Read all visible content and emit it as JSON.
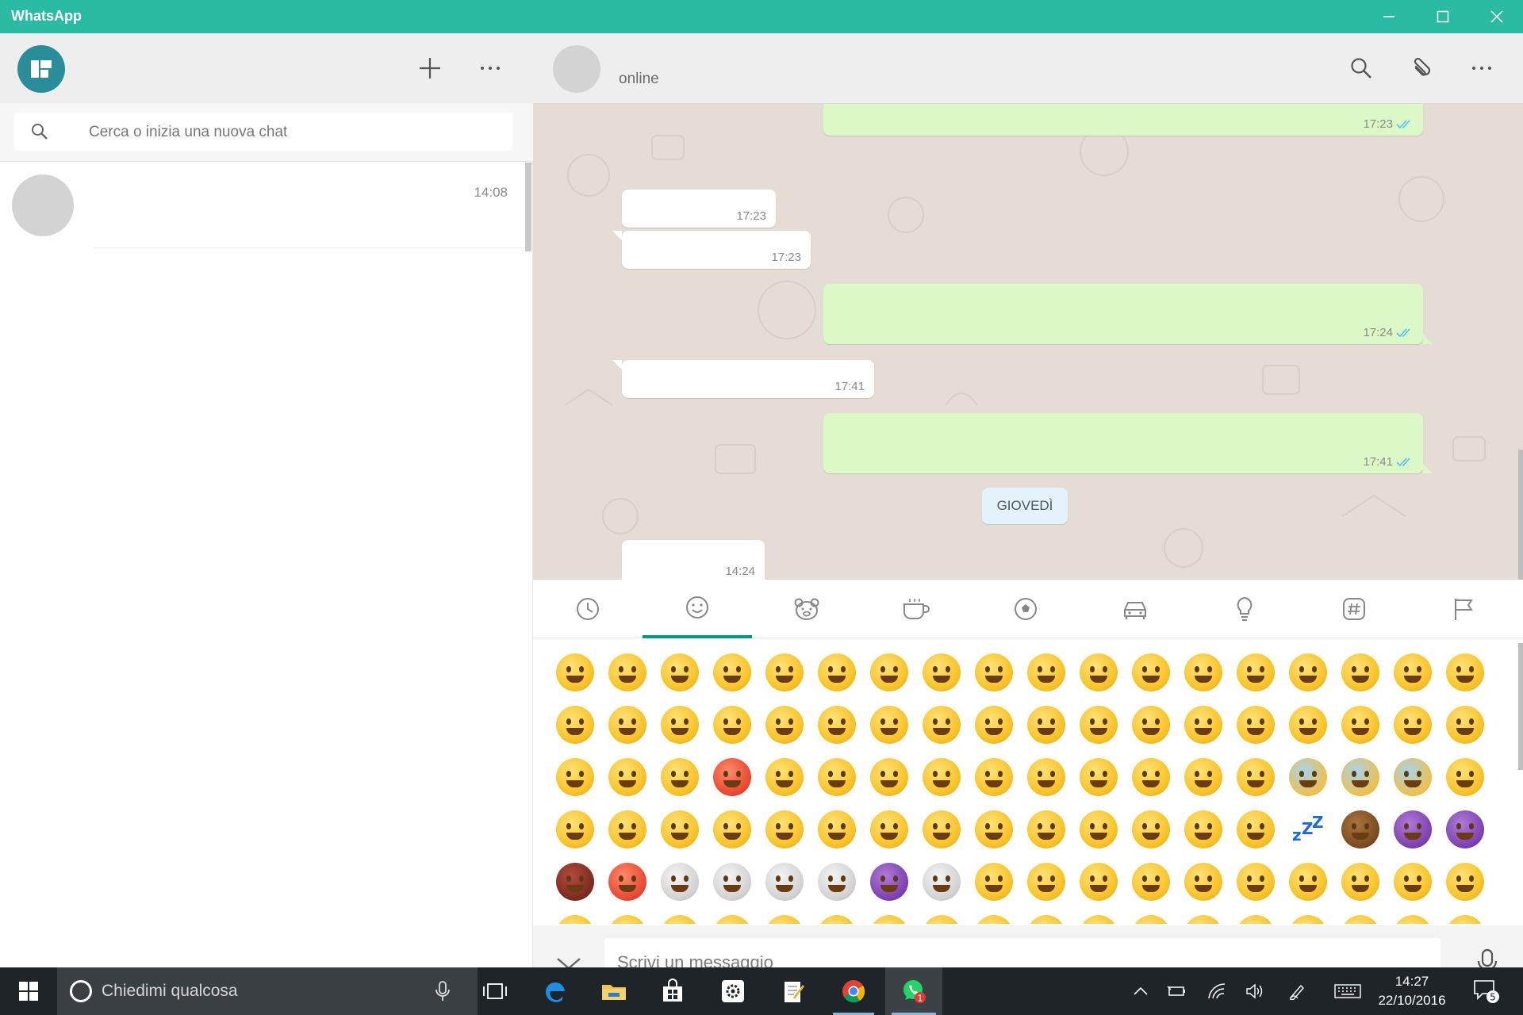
{
  "window": {
    "title": "WhatsApp",
    "accent_color": "#2bbba4"
  },
  "left_panel": {
    "search_placeholder": "Cerca o inizia una nuova chat",
    "chats": [
      {
        "time": "14:08"
      }
    ]
  },
  "chat": {
    "contact_status": "online",
    "messages": [
      {
        "dir": "out",
        "time": "17:23",
        "ticks": "read"
      },
      {
        "dir": "in",
        "time": "17:23"
      },
      {
        "dir": "in",
        "time": "17:23"
      },
      {
        "dir": "out",
        "time": "17:24",
        "ticks": "read"
      },
      {
        "dir": "in",
        "time": "17:41"
      },
      {
        "dir": "out",
        "time": "17:41",
        "ticks": "read"
      },
      {
        "dir": "in",
        "time": "14:24"
      }
    ],
    "day_separator": "GIOVEDÌ",
    "incoming_color": "#ffffff",
    "outgoing_color": "#dcf8c6",
    "read_tick_color": "#4fc3f7"
  },
  "emoji_panel": {
    "tabs": [
      "clock-icon",
      "smiley-icon",
      "bear-icon",
      "cup-icon",
      "ball-icon",
      "car-icon",
      "bulb-icon",
      "hash-icon",
      "flag-icon"
    ],
    "active_tab": 1,
    "active_color": "#009688"
  },
  "composer": {
    "placeholder": "Scrivi un messaggio"
  },
  "taskbar": {
    "search_text": "Chiedimi qualcosa",
    "time": "14:27",
    "date": "22/10/2016",
    "whatsapp_badge": "1",
    "notifications_count": "5"
  }
}
